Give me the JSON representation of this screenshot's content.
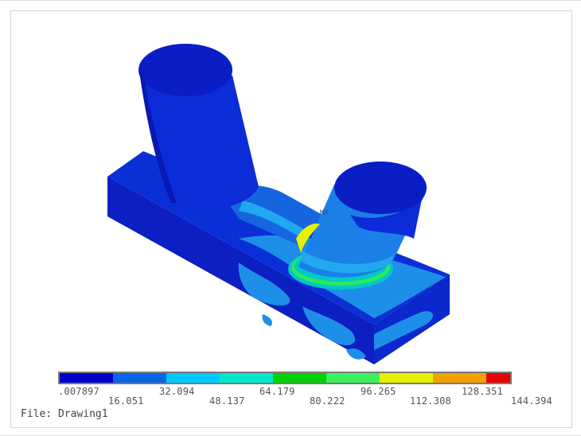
{
  "legend": {
    "colors": [
      "#0000c8",
      "#0a64e6",
      "#00c8ff",
      "#00e6c8",
      "#00d000",
      "#3cf05a",
      "#e6f000",
      "#f0a000",
      "#e60000"
    ],
    "ticks_top": [
      ".007897",
      "32.094",
      "64.179",
      "96.265",
      "128.351"
    ],
    "ticks_bottom": [
      "16.051",
      "48.137",
      "80.222",
      "112.308",
      "144.394"
    ]
  },
  "annotations": {
    "max_marker": "MX"
  },
  "footer": {
    "file_label": "File: Drawing1"
  }
}
